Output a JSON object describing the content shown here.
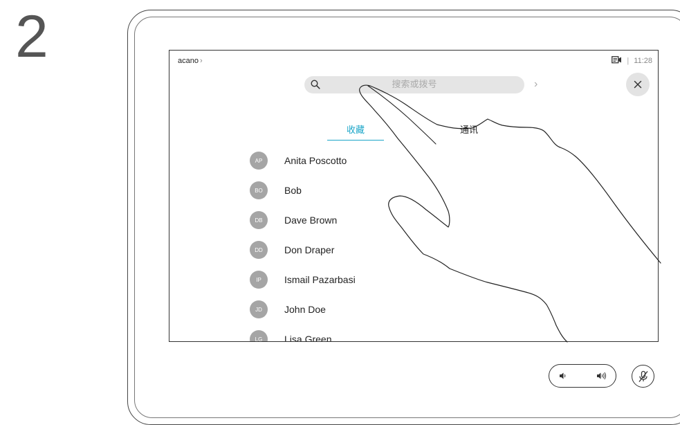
{
  "step": {
    "number": "2"
  },
  "header": {
    "breadcrumb": "acano",
    "breadcrumb_chevron": "›",
    "time": "11:28",
    "call_icon": "video-call-icon"
  },
  "search": {
    "placeholder": "搜索或拨号",
    "value": "",
    "icon": "search-icon",
    "go_arrow": "›"
  },
  "close_icon": "close-icon",
  "tabs": [
    {
      "label": "收藏",
      "active": true
    },
    {
      "label": "通讯",
      "active": false
    }
  ],
  "contacts": [
    {
      "initials": "AP",
      "name": "Anita Poscotto"
    },
    {
      "initials": "BO",
      "name": "Bob"
    },
    {
      "initials": "DB",
      "name": "Dave Brown"
    },
    {
      "initials": "DD",
      "name": "Don Draper"
    },
    {
      "initials": "IP",
      "name": "Ismail Pazarbasi"
    },
    {
      "initials": "JD",
      "name": "John Doe"
    },
    {
      "initials": "LG",
      "name": "Lisa Green"
    }
  ],
  "controls": {
    "volume_down_icon": "volume-down-icon",
    "volume_up_icon": "volume-up-icon",
    "mute_icon": "microphone-muted-icon"
  },
  "colors": {
    "accent": "#1aa5c8",
    "avatar": "#a5a5a5",
    "search_bg": "#e5e5e5"
  }
}
